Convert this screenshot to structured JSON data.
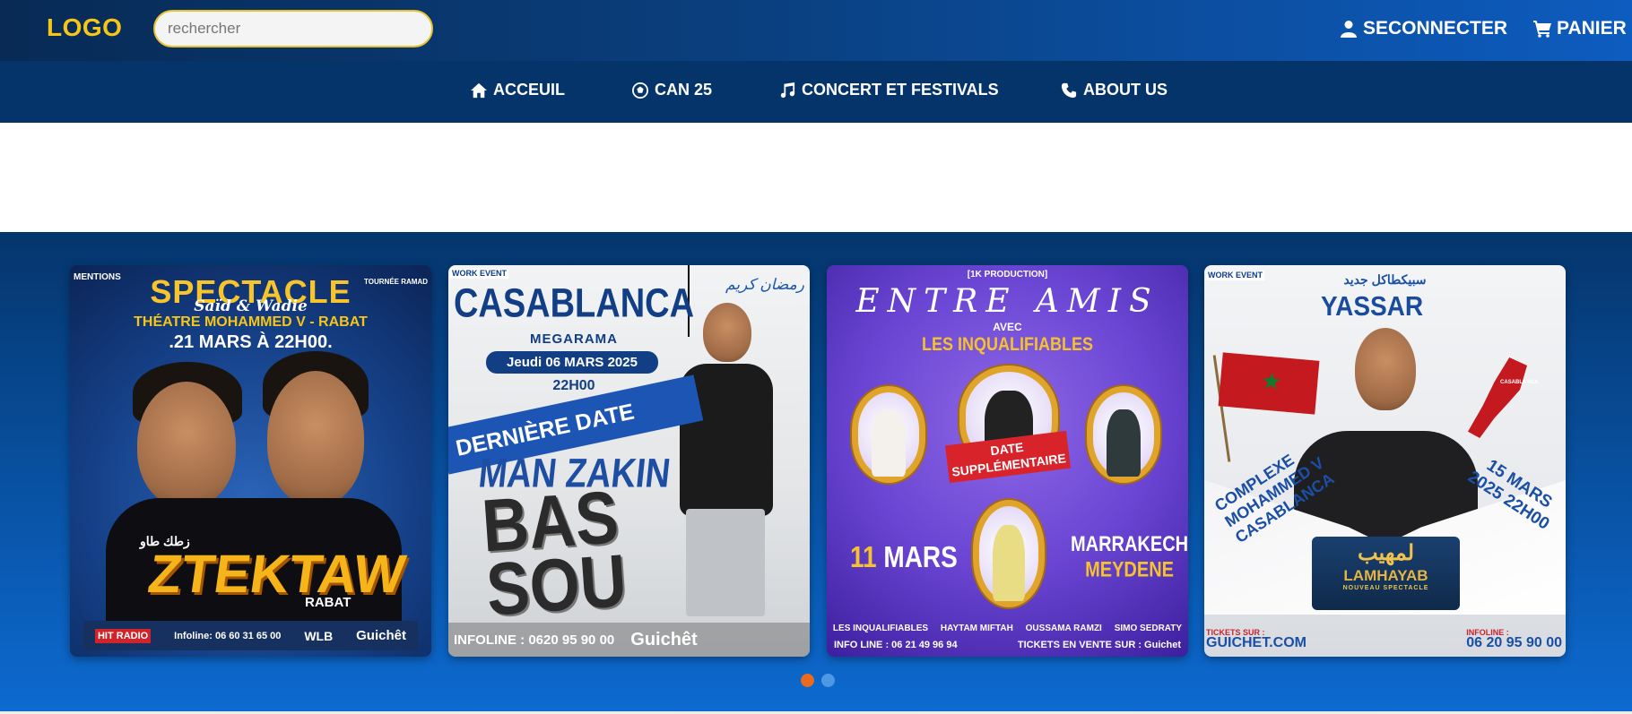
{
  "header": {
    "logo": "LOGO",
    "search_placeholder": "rechercher",
    "login_label": "SECONNECTER",
    "cart_label": "PANIER"
  },
  "nav": {
    "items": [
      {
        "label": "ACCEUIL",
        "icon": "home-icon"
      },
      {
        "label": "CAN 25",
        "icon": "soccer-ball-icon"
      },
      {
        "label": "CONCERT ET FESTIVALS",
        "icon": "music-note-icon"
      },
      {
        "label": "ABOUT US",
        "icon": "phone-icon"
      }
    ]
  },
  "posters": [
    {
      "title": "SPECTACLE",
      "subtitle": "Saïd & Wadie",
      "venue": "THÉATRE MOHAMMED V - RABAT",
      "date": ".21 MARS À 22H00.",
      "corner_left": "MENTIONS",
      "corner_right": "TOURNÉE RAMAD",
      "art_title": "ZTEKTAW",
      "art_arabic": "زطك طاو",
      "art_city": "RABAT",
      "sponsor_1": "HIT RADIO",
      "infoline": "Infoline: 06 60 31 65 00",
      "sponsor_2": "WLB",
      "sponsor_3": "Guichêt"
    },
    {
      "tag": "WORK EVENT",
      "arabic_badge": "رمضان كريم",
      "city": "CASABLANCA",
      "venue": "MEGARAMA",
      "date": "Jeudi 06 MARS 2025",
      "time": "22H00",
      "ribbon": "DERNIÈRE DATE",
      "name": "MAN ZAKIN",
      "show": "BAS SOU",
      "infoline": "INFOLINE : 0620 95 90 00",
      "sponsor": "Guichêt"
    },
    {
      "production": "[1K PRODUCTION]",
      "title": "ENTRE AMIS",
      "avec": "AVEC",
      "group": "LES INQUALIFIABLES",
      "badge": "DATE SUPPLÉMENTAIRE",
      "day_num": "11",
      "day_month": "MARS",
      "city": "MARRAKECH",
      "venue": "MEYDENE",
      "names": [
        "LES INQUALIFIABLES",
        "HAYTAM MIFTAH",
        "OUSSAMA RAMZI",
        "SIMO SEDRATY"
      ],
      "infoline": "INFO LINE : 06 21 49 96 94",
      "tickets": "TICKETS EN VENTE SUR : Guichet"
    },
    {
      "tag": "WORK EVENT",
      "arabic_title": "سبيكطاكل جديد",
      "name": "YASSAR",
      "map_label": "CASABLANCA",
      "location": "COMPLEXE MOHAMMED V CASABLANCA",
      "date": "15 MARS 2025 22H00",
      "show_arabic": "لمهيب",
      "show": "LAMHAYAB",
      "show_sub": "NOUVEAU SPECTACLE",
      "tickets_label": "TICKETS SUR :",
      "tickets_site": "GUICHET.COM",
      "infoline_label": "INFOLINE :",
      "infoline": "06 20 95 90 00"
    }
  ],
  "carousel": {
    "slides": 2,
    "active": 1
  }
}
